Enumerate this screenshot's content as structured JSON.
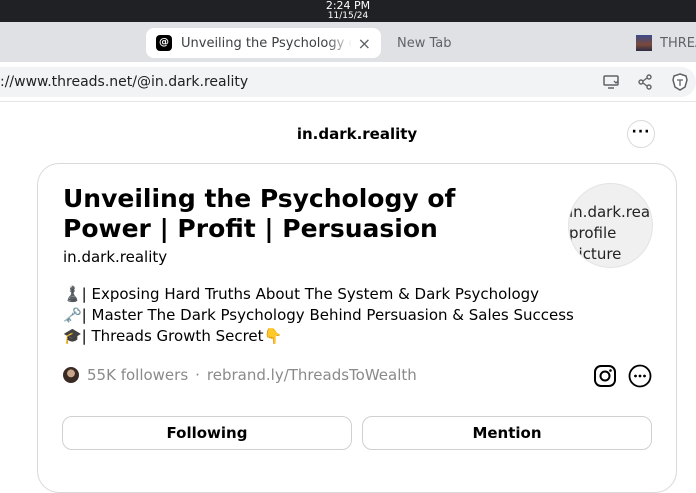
{
  "os": {
    "time": "2:24 PM",
    "date": "11/15/24"
  },
  "tabs": [
    {
      "label": "Unveiling the Psychology of Power | Profit | Persuasion",
      "active": true,
      "favicon": "threads-icon"
    },
    {
      "label": "New Tab",
      "active": false
    },
    {
      "label": "THREA",
      "active": false
    }
  ],
  "address_bar": {
    "url": "://www.threads.net/@in.dark.reality"
  },
  "icons": {
    "install": "install-app-icon",
    "share": "share-icon",
    "brave": "brave-lion-icon",
    "instagram": "instagram-icon",
    "more": "more-icon"
  },
  "header": {
    "handle": "in.dark.reality"
  },
  "profile": {
    "name": "Unveiling the Psychology of Power | Profit | Persuasion",
    "username": "in.dark.reality",
    "picture_alt": "in.dark.reality's\nprofile\npicture",
    "bio": [
      "♟️| Exposing Hard Truths About The System & Dark Psychology",
      "🗝️| Master The Dark Psychology Behind Persuasion & Sales Success",
      "🎓| Threads Growth Secret👇"
    ],
    "followers": "55K followers",
    "separator": "·",
    "link": "rebrand.ly/ThreadsToWealth"
  },
  "buttons": {
    "following": "Following",
    "mention": "Mention"
  }
}
